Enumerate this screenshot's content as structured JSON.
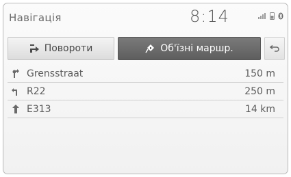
{
  "header": {
    "title": "Навігація",
    "time": "8:14",
    "status_icons": [
      "signal-bars-icon",
      "phone-battery-icon",
      "bluetooth-icon"
    ]
  },
  "tabs": [
    {
      "label": "Повороти",
      "icon": "turn-list-icon",
      "active": false
    },
    {
      "label": "Об'їзні маршр.",
      "icon": "detour-icon",
      "active": true
    }
  ],
  "back_button": {
    "icon": "back-arrow-icon"
  },
  "route_list": [
    {
      "icon": "turn-right-sign-icon",
      "name": "Grensstraat",
      "distance": "150 m"
    },
    {
      "icon": "keep-left-sign-icon",
      "name": "R22",
      "distance": "250 m"
    },
    {
      "icon": "straight-arrow-icon",
      "name": "E313",
      "distance": "14 km"
    }
  ],
  "colors": {
    "active_tab": "#686868",
    "text": "#5b5b5b",
    "accent_clock": "#5a5a5a"
  }
}
